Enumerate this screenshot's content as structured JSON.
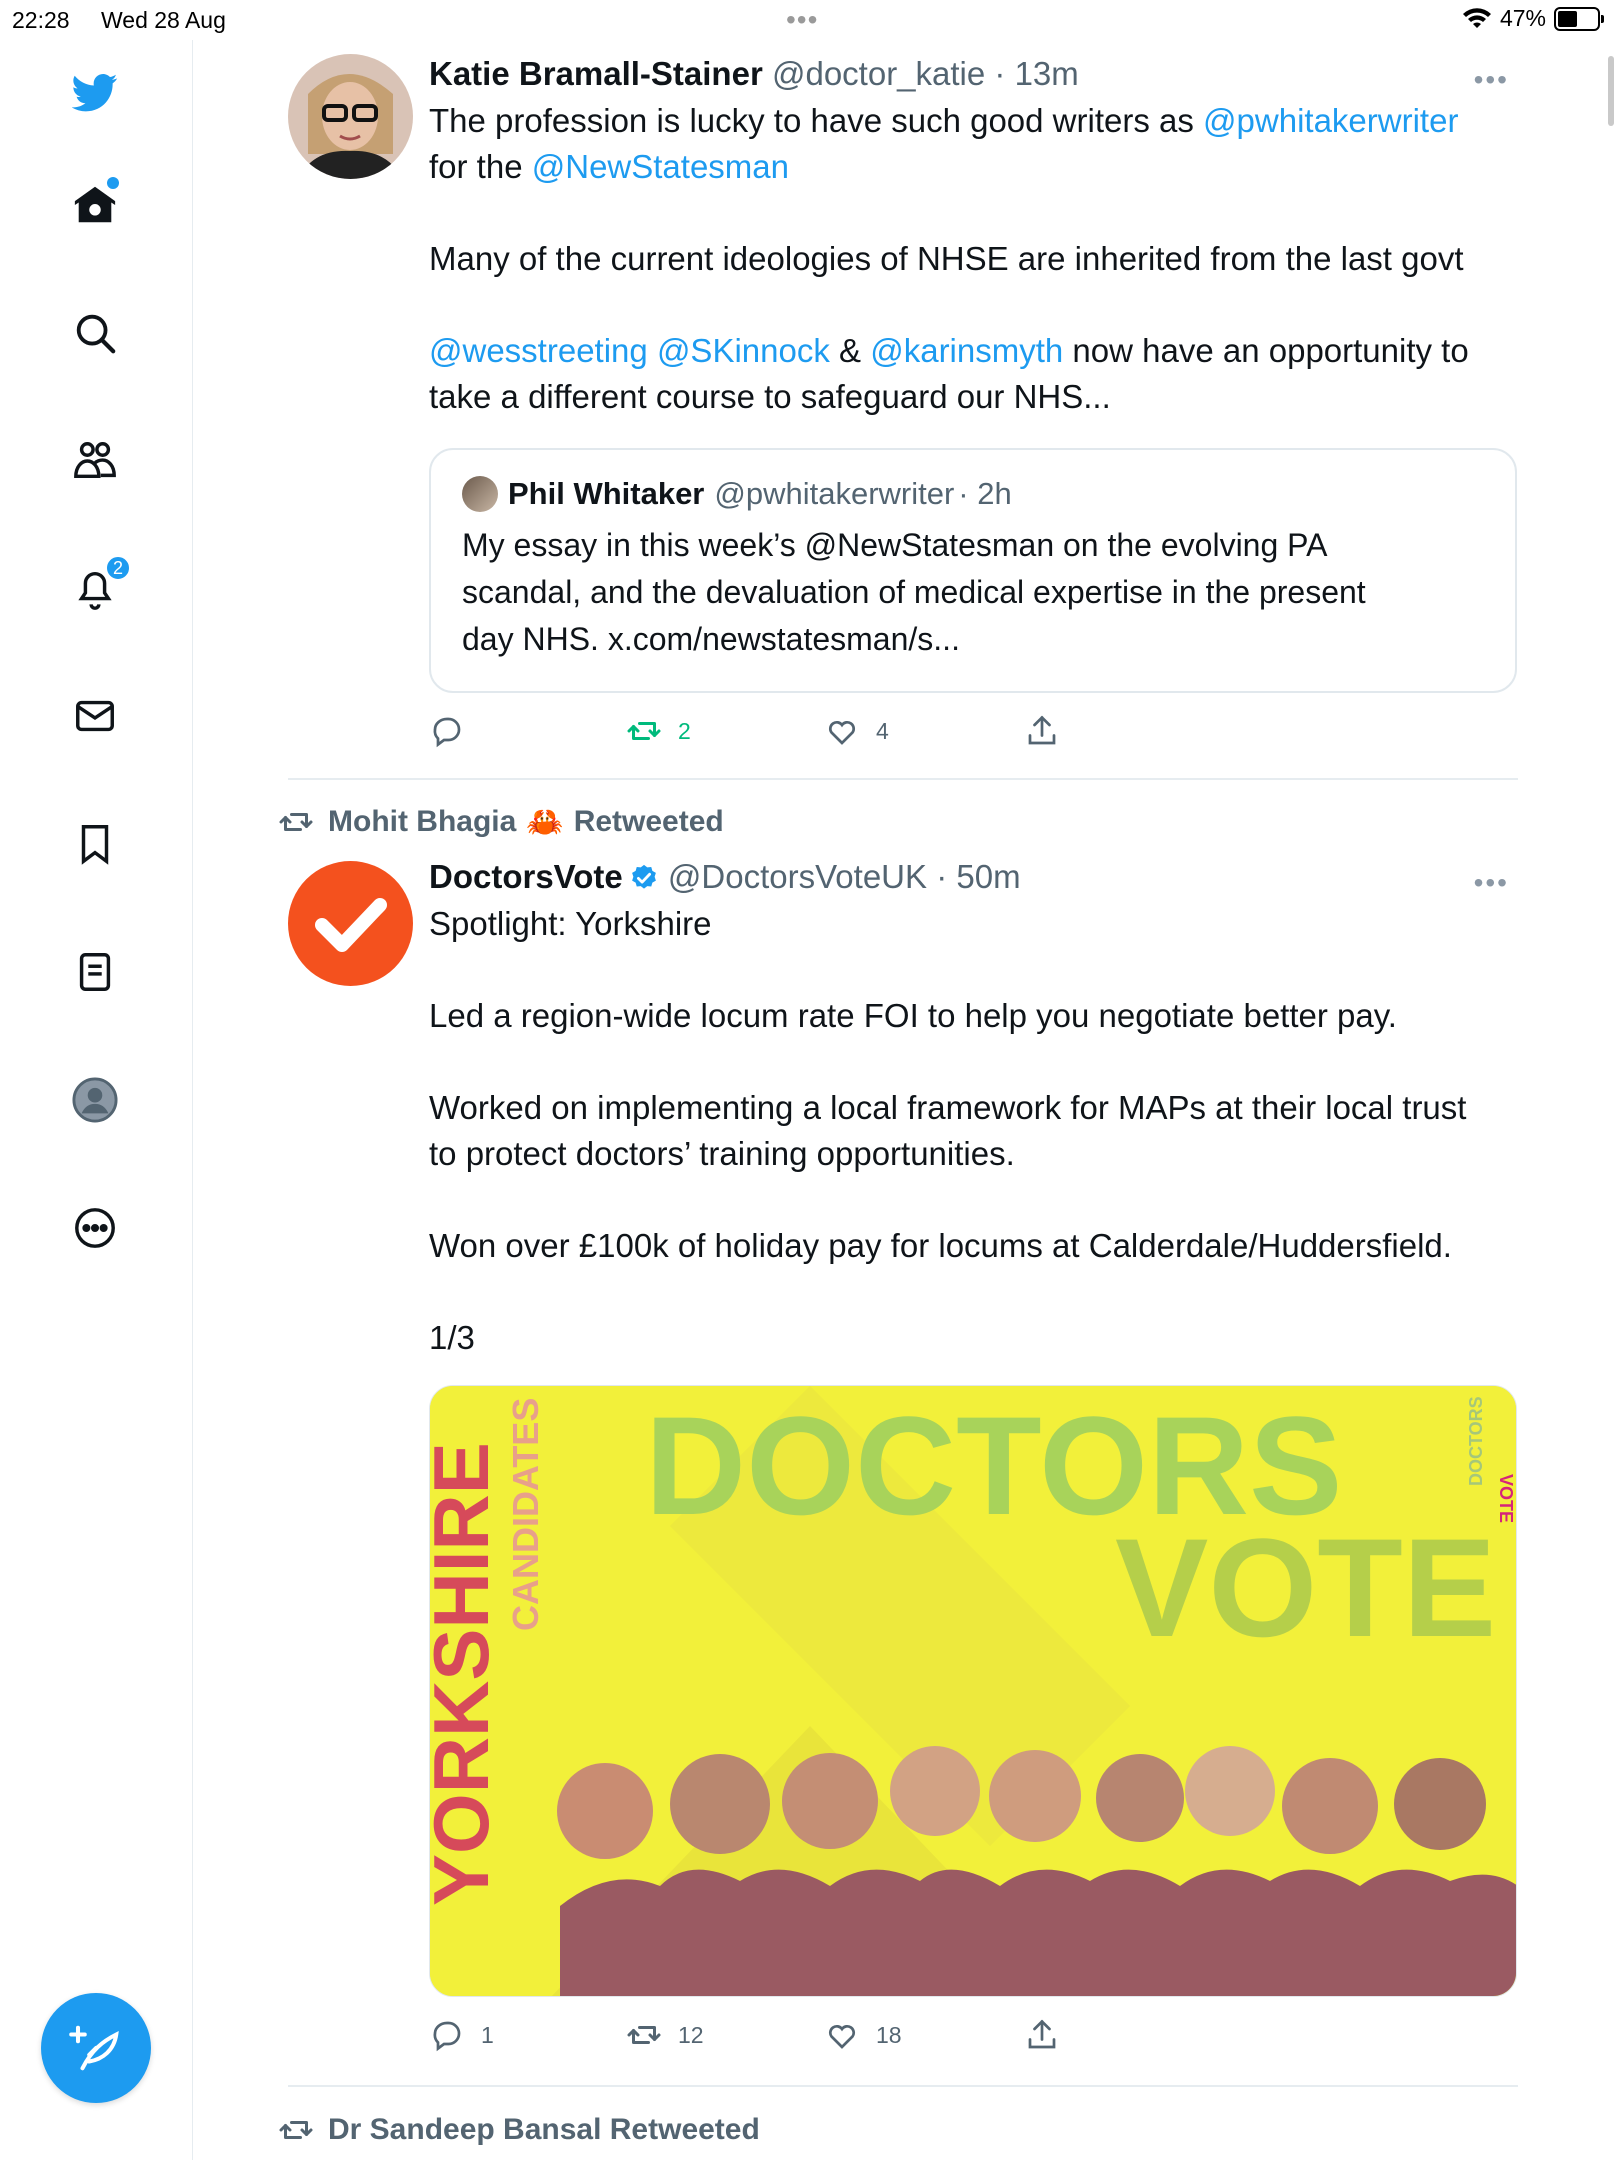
{
  "status": {
    "time": "22:28",
    "date": "Wed 28 Aug",
    "battery": "47%"
  },
  "sidebar": {
    "items": [
      {
        "name": "home",
        "badge": ""
      },
      {
        "name": "explore",
        "badge": ""
      },
      {
        "name": "communities",
        "badge": ""
      },
      {
        "name": "notifications",
        "badge": "2"
      },
      {
        "name": "messages",
        "badge": ""
      },
      {
        "name": "bookmarks",
        "badge": ""
      },
      {
        "name": "lists",
        "badge": ""
      },
      {
        "name": "profile",
        "badge": ""
      },
      {
        "name": "more",
        "badge": ""
      }
    ]
  },
  "tweets": [
    {
      "name": "Katie Bramall-Stainer",
      "handle": "@doctor_katie",
      "time": "· 13m",
      "more": "•••",
      "line1_pre": "The profession is lucky to have such good writers as ",
      "line1_mention": "@pwhitakerwriter",
      "line2_pre": "for the ",
      "line2_mention": "@NewStatesman",
      "para2": "Many of the current ideologies of NHSE are inherited from the last govt",
      "para3_m1": "@wesstreeting",
      "para3_m2": "@SKinnock",
      "para3_amp": " & ",
      "para3_m3": "@karinsmyth",
      "para3_rest": " now have an opportunity to",
      "para3_line2": "take a different course to safeguard our NHS...",
      "quote": {
        "name": "Phil Whitaker",
        "handle": "@pwhitakerwriter",
        "time": "· 2h",
        "line1": "My essay in this week’s @NewStatesman on the evolving PA",
        "line2": "scandal, and the devaluation of medical expertise in the present",
        "line3": "day NHS. x.com/newstatesman/s..."
      },
      "replies": "",
      "retweets": "2",
      "likes": "4"
    },
    {
      "retweeted_by": "Mohit Bhagia",
      "retweeted_emoji": "🦀",
      "retweeted_label": "Retweeted",
      "name": "DoctorsVote",
      "handle": "@DoctorsVoteUK",
      "time": "· 50m",
      "more": "•••",
      "l1": "Spotlight: Yorkshire",
      "l2": "Led a region-wide locum rate FOI to help you negotiate better pay.",
      "l3": "Worked on implementing a local framework for MAPs at their local trust",
      "l4": "to protect doctors’ training opportunities.",
      "l5": "Won over £100k of holiday pay for locums at Calderdale/Huddersfield.",
      "l6": "1/3",
      "media": {
        "yorkshire": "YORKSHIRE",
        "candidates": "CANDIDATES",
        "doctors": "DOCTORS",
        "vote": "VOTE",
        "logo_small_1": "DOCTORS",
        "logo_small_2": "VOTE"
      },
      "replies": "1",
      "retweets": "12",
      "likes": "18"
    },
    {
      "retweeted_by": "Dr Sandeep Bansal Retweeted"
    }
  ],
  "colors": {
    "accent": "#1d9bf0",
    "retweet_green": "#00ba7c",
    "muted": "#536471",
    "doctorsvote_orange": "#f4511e",
    "media_yellow": "#f2f03a"
  }
}
